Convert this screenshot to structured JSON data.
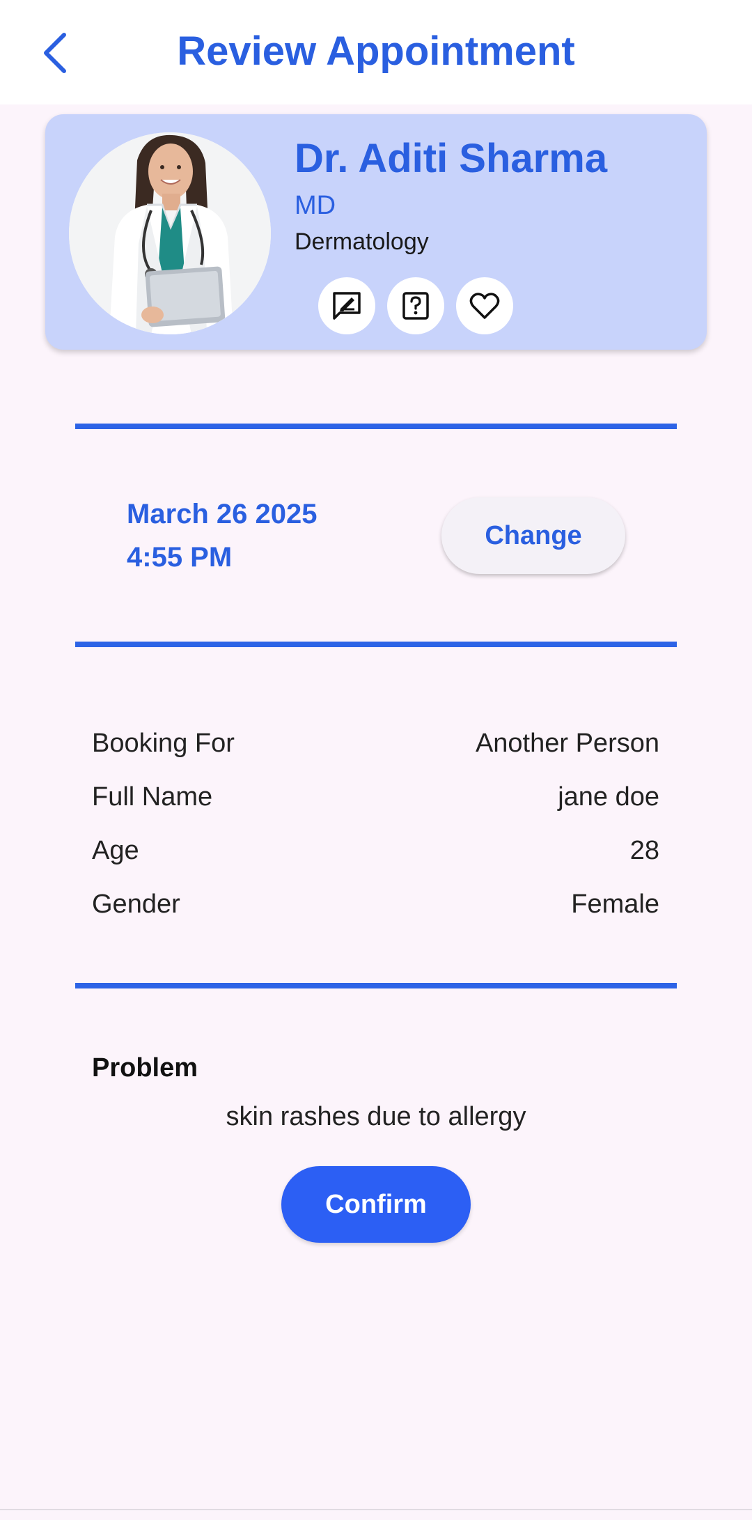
{
  "header": {
    "title": "Review Appointment",
    "back_icon": "chevron-left-icon"
  },
  "doctor": {
    "name": "Dr. Aditi Sharma",
    "degree": "MD",
    "specialty": "Dermatology",
    "actions": [
      {
        "icon": "message-edit-icon"
      },
      {
        "icon": "question-icon"
      },
      {
        "icon": "heart-icon"
      }
    ]
  },
  "appointment": {
    "date": "March 26 2025",
    "time": "4:55 PM",
    "change_label": "Change"
  },
  "details": [
    {
      "label": "Booking For",
      "value": "Another Person"
    },
    {
      "label": "Full Name",
      "value": "jane doe"
    },
    {
      "label": "Age",
      "value": "28"
    },
    {
      "label": "Gender",
      "value": "Female"
    }
  ],
  "problem": {
    "heading": "Problem",
    "text": "skin rashes due to allergy"
  },
  "confirm_label": "Confirm",
  "colors": {
    "accent": "#2a5fe0",
    "card_background": "#c8d3fb",
    "page_background": "#fcf4fb",
    "confirm_button": "#2c5ff4"
  }
}
